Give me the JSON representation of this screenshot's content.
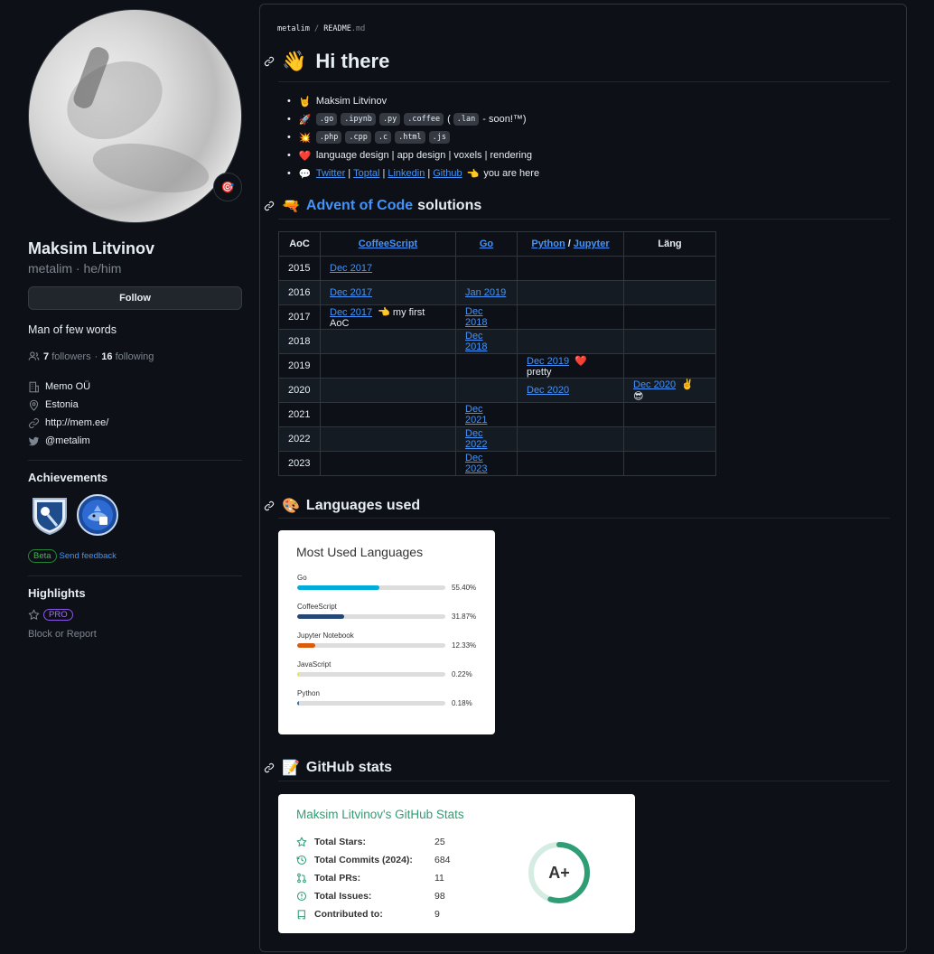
{
  "profile": {
    "name": "Maksim Litvinov",
    "login": "metalim · he/him",
    "status_emoji": "🎯",
    "follow_label": "Follow",
    "bio": "Man of few words",
    "followers_count": "7",
    "followers_label": "followers",
    "dot": "·",
    "following_count": "16",
    "following_label": "following",
    "company": "Memo OÜ",
    "location": "Estonia",
    "website": "http://mem.ee/",
    "twitter": "@metalim"
  },
  "achievements": {
    "title": "Achievements",
    "badges": [
      "pull-shark-badge",
      "arctic-code-vault-badge"
    ],
    "beta_label": "Beta",
    "feedback_label": "Send feedback"
  },
  "highlights": {
    "title": "Highlights",
    "pro_label": "PRO",
    "block_report": "Block or Report"
  },
  "readme": {
    "path_user": "metalim",
    "path_sep": " / ",
    "path_file": "README",
    "path_ext": ".md",
    "greeting_emoji": "👋",
    "greeting": "Hi there",
    "bullets": [
      {
        "emoji": "🤘",
        "text": "Maksim Litvinov"
      },
      {
        "emoji": "🚀",
        "codes": [
          ".go",
          ".ipynb",
          ".py",
          ".coffee"
        ],
        "paren_open": "(",
        "extra_code": ".lan",
        "tail": "- soon!™)"
      },
      {
        "emoji": "💥",
        "codes": [
          ".php",
          ".cpp",
          ".c",
          ".html",
          ".js"
        ]
      },
      {
        "emoji": "❤️",
        "text": "language design | app design | voxels | rendering"
      },
      {
        "emoji": "💬",
        "links": [
          "Twitter",
          "Toptal",
          "Linkedin",
          "Github"
        ],
        "sep": "|",
        "tail_emoji": "👈",
        "tail": "you are here"
      }
    ],
    "aoc_emoji": "🔫",
    "aoc_link": "Advent of Code",
    "aoc_rest": "solutions",
    "aoc_table": {
      "headers": [
        "AoC",
        "CoffeeScript",
        "Go",
        "Python",
        "/",
        "Jupyter",
        "Läng"
      ],
      "rows": [
        [
          "2015",
          "Dec 2017",
          "",
          "",
          "",
          "",
          ""
        ],
        [
          "2016",
          "Dec 2017",
          "Jan 2019",
          "",
          "",
          "",
          ""
        ],
        [
          "2017",
          "Dec 2017",
          "Dec 2018",
          "",
          "",
          "👈 my first AoC",
          ""
        ],
        [
          "2018",
          "",
          "Dec 2018",
          "",
          "",
          "",
          ""
        ],
        [
          "2019",
          "",
          "",
          "Dec 2019",
          "❤️ pretty",
          "",
          ""
        ],
        [
          "2020",
          "",
          "",
          "Dec 2020",
          "",
          "",
          "Dec 2020"
        ],
        [
          "2021",
          "",
          "Dec 2021",
          "",
          "",
          "",
          ""
        ],
        [
          "2022",
          "",
          "Dec 2022",
          "",
          "",
          "",
          ""
        ],
        [
          "2023",
          "",
          "Dec 2023",
          "",
          "",
          "",
          ""
        ]
      ],
      "extra_2020": "✌️ 😎"
    },
    "lang_emoji": "🎨",
    "lang_heading": "Languages used",
    "stats_emoji": "📝",
    "stats_heading": "GitHub stats"
  },
  "languages_card": {
    "title": "Most Used Languages",
    "items": [
      {
        "name": "Go",
        "percent": 55.4,
        "label": "55.40%",
        "color": "#00ADD8"
      },
      {
        "name": "CoffeeScript",
        "percent": 31.87,
        "label": "31.87%",
        "color": "#244776"
      },
      {
        "name": "Jupyter Notebook",
        "percent": 12.33,
        "label": "12.33%",
        "color": "#DA5B0B"
      },
      {
        "name": "JavaScript",
        "percent": 0.22,
        "label": "0.22%",
        "color": "#f1e05a"
      },
      {
        "name": "Python",
        "percent": 0.18,
        "label": "0.18%",
        "color": "#3572A5"
      }
    ]
  },
  "stats_card": {
    "title": "Maksim Litvinov's GitHub Stats",
    "rows": [
      {
        "icon": "star-icon",
        "label": "Total Stars:",
        "value": "25"
      },
      {
        "icon": "history-icon",
        "label": "Total Commits (2024):",
        "value": "684"
      },
      {
        "icon": "pull-request-icon",
        "label": "Total PRs:",
        "value": "11"
      },
      {
        "icon": "issue-icon",
        "label": "Total Issues:",
        "value": "98"
      },
      {
        "icon": "repo-icon",
        "label": "Contributed to:",
        "value": "9"
      }
    ],
    "rank": "A+",
    "rank_progress": 0.55,
    "accent": "#2f9e74"
  }
}
